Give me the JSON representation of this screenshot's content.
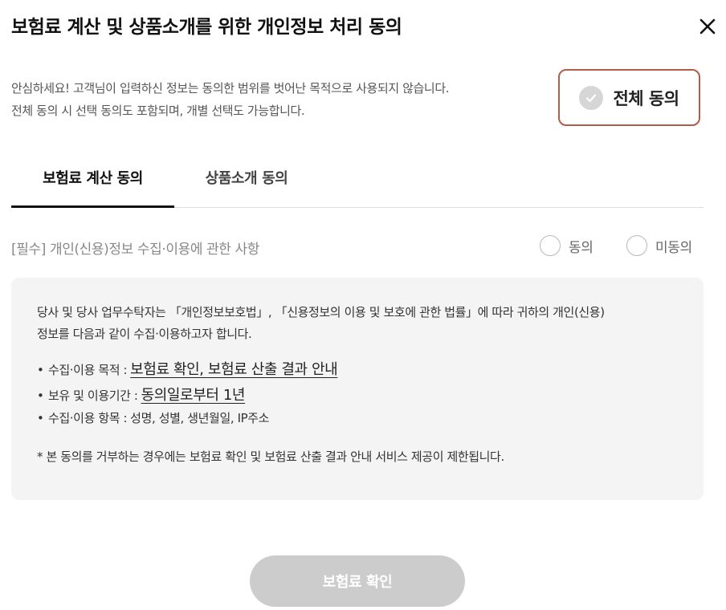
{
  "modal": {
    "title": "보험료 계산 및 상품소개를 위한 개인정보 처리 동의"
  },
  "intro": {
    "line1": "안심하세요! 고객님이 입력하신 정보는 동의한 범위를 벗어난 목적으로 사용되지 않습니다.",
    "line2": "전체 동의 시 선택 동의도 포함되며, 개별 선택도 가능합니다."
  },
  "agree_all": {
    "label": "전체 동의",
    "checked": false
  },
  "tabs": [
    {
      "label": "보험료 계산 동의",
      "active": true
    },
    {
      "label": "상품소개 동의",
      "active": false
    }
  ],
  "section": {
    "title": "[필수] 개인(신용)정보 수집·이용에 관한 사항",
    "agree_label": "동의",
    "disagree_label": "미동의"
  },
  "content": {
    "para_line1": "당사 및 당사 업무수탁자는 「개인정보보호법」, 「신용정보의 이용 및 보호에 관한 법률」에 따라 귀하의 개인(신용)",
    "para_line2": "정보를 다음과 같이 수집·이용하고자 합니다.",
    "bullets": [
      {
        "key": "수집·이용 목적 :",
        "value": "보험료 확인, 보험료 산출 결과 안내",
        "emphasis": true
      },
      {
        "key": "보유 및 이용기간 :",
        "value": "동의일로부터 1년",
        "emphasis": true
      },
      {
        "key": "수집·이용 항목 :",
        "value": "성명, 성별, 생년월일, IP주소",
        "emphasis": false
      }
    ],
    "notice": "* 본 동의를 거부하는 경우에는 보험료 확인 및 보험료 산출 결과 안내 서비스 제공이 제한됩니다."
  },
  "confirm_button": {
    "label": "보험료 확인"
  },
  "colors": {
    "accent_border": "#b25c4a",
    "box_bg": "#f4f4f4",
    "disabled_button": "#cccccc"
  }
}
